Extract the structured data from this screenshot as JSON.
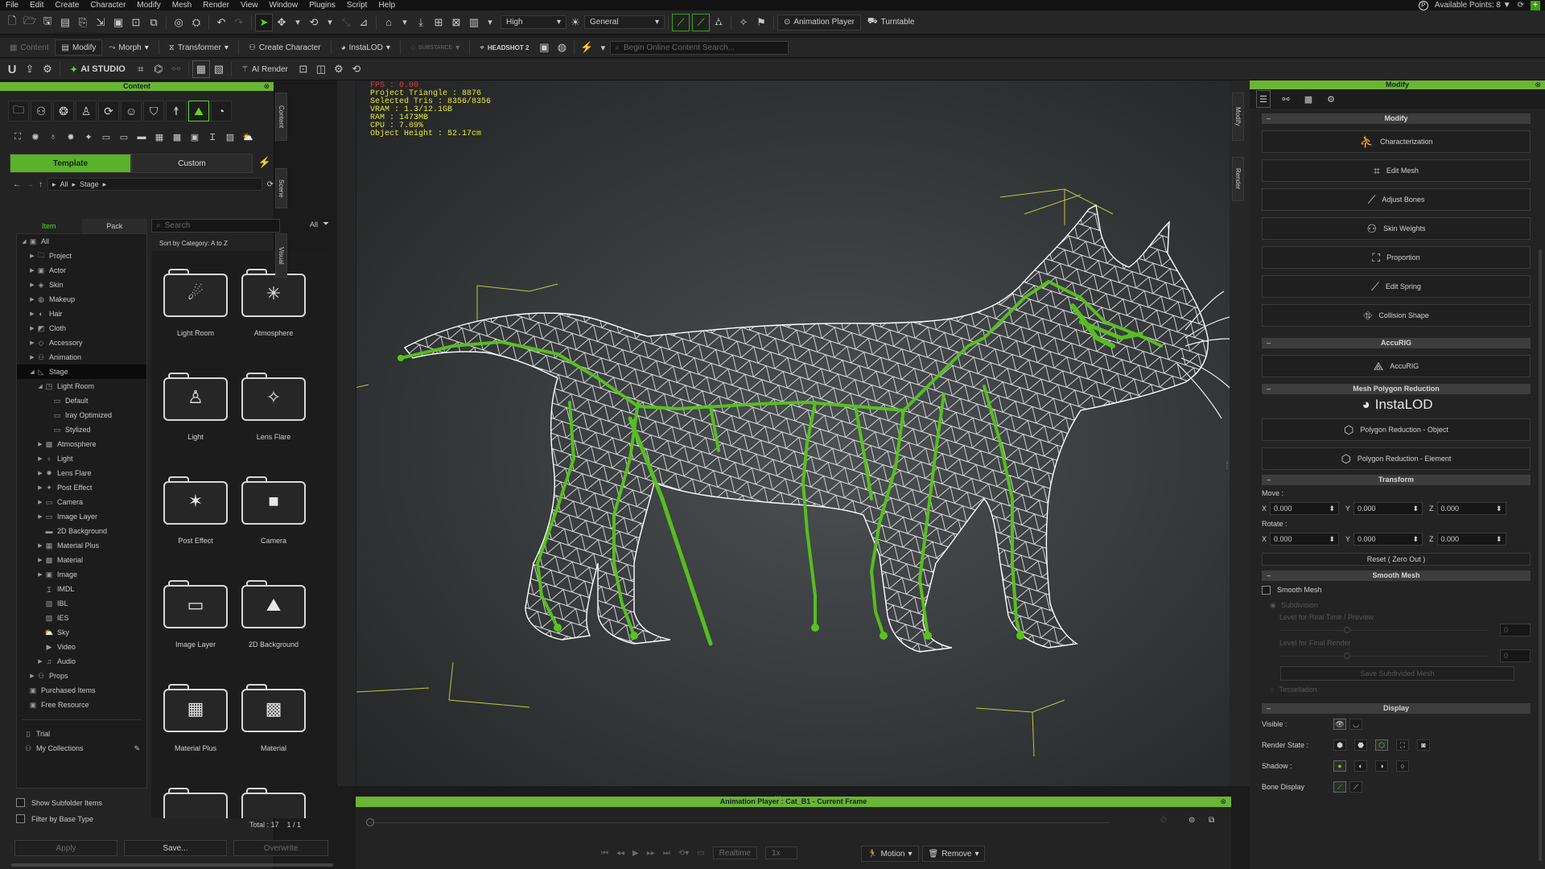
{
  "menu": [
    "File",
    "Edit",
    "Create",
    "Character",
    "Modify",
    "Mesh",
    "Render",
    "View",
    "Window",
    "Plugins",
    "Script",
    "Help"
  ],
  "account": {
    "available_points": "Available Points: 8 ▼"
  },
  "toolbar1": {
    "quality": "High",
    "mode": "General",
    "animation_player": "Animation Player",
    "turntable": "Turntable"
  },
  "toolbar2": {
    "content": "Content",
    "modify": "Modify",
    "morph": "Morph",
    "transformer": "Transformer",
    "create_character": "Create Character",
    "instalod": "InstaLOD",
    "substance": "SUBSTANCE",
    "headshot": "HEADSHOT 2",
    "search_placeholder": "Begin Online Content Search..."
  },
  "toolbar3": {
    "ai_studio": "AI STUDIO",
    "ai_render": "AI Render"
  },
  "content_panel": {
    "title": "Content",
    "tabs": [
      "Template",
      "Custom"
    ],
    "breadcrumb": [
      "All",
      "Stage"
    ],
    "subtabs": [
      "Item",
      "Pack"
    ],
    "search_placeholder": "Search",
    "filter": "All",
    "sort": "Sort by Category: A to Z",
    "tree": [
      {
        "label": "All",
        "level": 0,
        "arrow": "◢"
      },
      {
        "label": "Project",
        "level": 1,
        "arrow": "▶"
      },
      {
        "label": "Actor",
        "level": 1,
        "arrow": "▶"
      },
      {
        "label": "Skin",
        "level": 1,
        "arrow": "▶"
      },
      {
        "label": "Makeup",
        "level": 1,
        "arrow": "▶"
      },
      {
        "label": "Hair",
        "level": 1,
        "arrow": "▶"
      },
      {
        "label": "Cloth",
        "level": 1,
        "arrow": "▶"
      },
      {
        "label": "Accessory",
        "level": 1,
        "arrow": "▶"
      },
      {
        "label": "Animation",
        "level": 1,
        "arrow": "▶"
      },
      {
        "label": "Stage",
        "level": 1,
        "arrow": "◢",
        "selected": true
      },
      {
        "label": "Light Room",
        "level": 2,
        "arrow": "◢"
      },
      {
        "label": "Default",
        "level": 3,
        "arrow": ""
      },
      {
        "label": "Iray Optimized",
        "level": 3,
        "arrow": ""
      },
      {
        "label": "Stylized",
        "level": 3,
        "arrow": ""
      },
      {
        "label": "Atmosphere",
        "level": 2,
        "arrow": "▶"
      },
      {
        "label": "Light",
        "level": 2,
        "arrow": "▶"
      },
      {
        "label": "Lens Flare",
        "level": 2,
        "arrow": "▶"
      },
      {
        "label": "Post Effect",
        "level": 2,
        "arrow": "▶"
      },
      {
        "label": "Camera",
        "level": 2,
        "arrow": "▶"
      },
      {
        "label": "Image Layer",
        "level": 2,
        "arrow": "▶"
      },
      {
        "label": "2D Background",
        "level": 2,
        "arrow": ""
      },
      {
        "label": "Material Plus",
        "level": 2,
        "arrow": "▶"
      },
      {
        "label": "Material",
        "level": 2,
        "arrow": "▶"
      },
      {
        "label": "Image",
        "level": 2,
        "arrow": "▶"
      },
      {
        "label": "IMDL",
        "level": 2,
        "arrow": ""
      },
      {
        "label": "IBL",
        "level": 2,
        "arrow": ""
      },
      {
        "label": "IES",
        "level": 2,
        "arrow": ""
      },
      {
        "label": "Sky",
        "level": 2,
        "arrow": ""
      },
      {
        "label": "Video",
        "level": 2,
        "arrow": ""
      },
      {
        "label": "Audio",
        "level": 2,
        "arrow": "▶"
      },
      {
        "label": "Props",
        "level": 1,
        "arrow": "▶"
      },
      {
        "label": "Purchased Items",
        "level": 0,
        "arrow": ""
      },
      {
        "label": "Free Resource",
        "level": 0,
        "arrow": ""
      }
    ],
    "extra_tree": [
      "Trial",
      "My Collections"
    ],
    "grid_items": [
      "Light Room",
      "Atmosphere",
      "Light",
      "Lens Flare",
      "Post Effect",
      "Camera",
      "Image Layer",
      "2D Background",
      "Material Plus",
      "Material"
    ],
    "show_subfolder": "Show Subfolder Items",
    "filter_base": "Filter by Base Type",
    "total": "Total : 17",
    "page": "1 / 1",
    "apply": "Apply",
    "save": "Save...",
    "overwrite": "Overwrite"
  },
  "side_tabs": [
    "Content",
    "Scene",
    "Visual"
  ],
  "right_side_tabs": [
    "Modify",
    "Render"
  ],
  "viewport": {
    "stats_fps": "FPS : 0.00",
    "stats": "Project Triangle : 8876\nSelected Tris : 8356/8356\nVRAM : 1.3/12.1GB\nRAM : 1473MB\nCPU : 7.09%\nObject Height : 52.17cm"
  },
  "anim_player": {
    "title": "Animation Player : Cat_B1 - Current Frame",
    "realtime": "Realtime",
    "speed": "1x",
    "motion": "Motion",
    "remove": "Remove"
  },
  "modify_panel": {
    "title": "Modify",
    "section_modify": "Modify",
    "buttons": [
      "Characterization",
      "Edit Mesh",
      "Adjust Bones",
      "Skin Weights",
      "Proportion",
      "Edit Spring",
      "Collision Shape"
    ],
    "section_accurig": "AccuRIG",
    "accurig": "AccuRIG",
    "section_reduction": "Mesh Polygon Reduction",
    "instalod": "InstaLOD",
    "reduction_object": "Polygon Reduction - Object",
    "reduction_element": "Polygon Reduction - Element",
    "section_transform": "Transform",
    "move_label": "Move :",
    "rotate_label": "Rotate :",
    "move": {
      "x": "0.000",
      "y": "0.000",
      "z": "0.000"
    },
    "rotate": {
      "x": "0.000",
      "y": "0.000",
      "z": "0.000"
    },
    "reset": "Reset ( Zero Out )",
    "section_smooth": "Smooth Mesh",
    "smooth_mesh": "Smooth Mesh",
    "subdivision": "Subdivision",
    "level_realtime": "Level for Real Time / Preview",
    "level_final": "Level for Final Render",
    "level_value": "0",
    "save_subdivided": "Save Subdivided Mesh",
    "tessellation": "Tessellation",
    "section_display": "Display",
    "visible": "Visible :",
    "render_state": "Render State :",
    "shadow": "Shadow :",
    "bone_display": "Bone Display"
  },
  "colors": {
    "accent": "#6ab533",
    "stats": "#e6e634",
    "bone": "#58c41f",
    "wire": "#ffffff"
  }
}
